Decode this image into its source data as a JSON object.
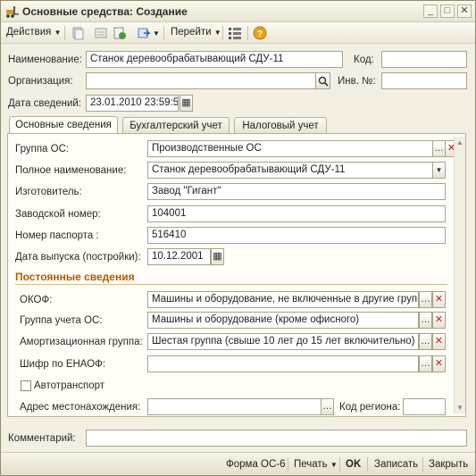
{
  "window": {
    "title": "Основные средства: Создание"
  },
  "toolbar": {
    "actions": "Действия",
    "goto": "Перейти"
  },
  "header": {
    "name_label": "Наименование:",
    "name_value": "Станок деревообрабатывающий СДУ-11",
    "code_label": "Код:",
    "code_value": "",
    "org_label": "Организация:",
    "org_value": "",
    "inv_label": "Инв. №:",
    "inv_value": "",
    "date_label": "Дата сведений:",
    "date_value": "23.01.2010 23:59:59"
  },
  "tabs": [
    {
      "label": "Основные сведения"
    },
    {
      "label": "Бухгалтерский учет"
    },
    {
      "label": "Налоговый учет"
    }
  ],
  "main": {
    "group_label": "Группа ОС:",
    "group_value": "Производственные ОС",
    "fullname_label": "Полное наименование:",
    "fullname_value": "Станок деревообрабатывающий СДУ-11",
    "maker_label": "Изготовитель:",
    "maker_value": "Завод \"Гигант\"",
    "serial_label": "Заводской номер:",
    "serial_value": "104001",
    "passport_label": "Номер паспорта :",
    "passport_value": "516410",
    "release_label": "Дата выпуска (постройки):",
    "release_value": "10.12.2001",
    "section_title": "Постоянные сведения",
    "okof_label": "ОКОФ:",
    "okof_value": "Машины и оборудование, не включенные в другие группир",
    "acc_group_label": "Группа учета ОС:",
    "acc_group_value": "Машины и оборудование (кроме офисного)",
    "amort_label": "Амортизационная группа:",
    "amort_value": "Шестая группа (свыше 10 лет до 15 лет включительно)",
    "enaof_label": "Шифр по ЕНАОФ:",
    "enaof_value": "",
    "auto_label": "Автотранспорт",
    "addr_label": "Адрес местонахождения:",
    "addr_value": "",
    "region_label": "Код региона:",
    "region_value": ""
  },
  "comment": {
    "label": "Комментарий:",
    "value": ""
  },
  "footer": {
    "form_os6": "Форма ОС-6",
    "print": "Печать",
    "ok": "OK",
    "save": "Записать",
    "close": "Закрыть"
  },
  "colors": {
    "section": "#b45a00",
    "help": "#e8a21a",
    "close_x": "#b22"
  }
}
